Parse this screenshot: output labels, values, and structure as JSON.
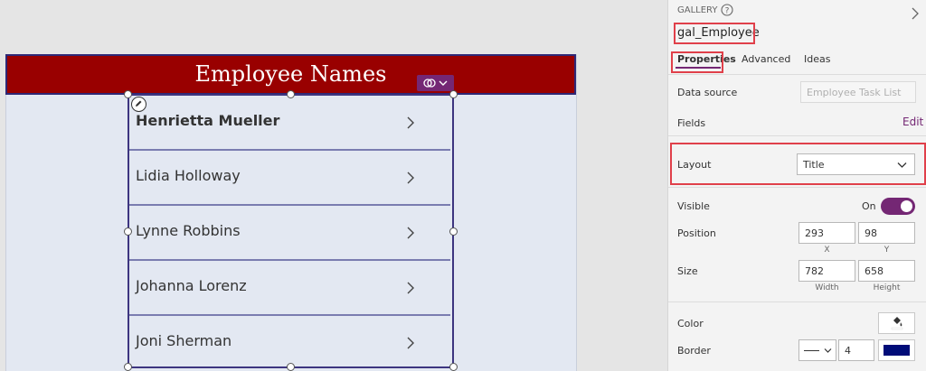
{
  "app_header": {
    "title": "Employee Names"
  },
  "gallery": {
    "items": [
      {
        "name": "Henrietta Mueller"
      },
      {
        "name": "Lidia Holloway"
      },
      {
        "name": "Lynne Robbins"
      },
      {
        "name": "Johanna Lorenz"
      },
      {
        "name": "Joni Sherman"
      }
    ]
  },
  "panel": {
    "section_label": "GALLERY",
    "control_name": "gal_Employee",
    "tabs": [
      {
        "label": "Properties",
        "active": true
      },
      {
        "label": "Advanced",
        "active": false
      },
      {
        "label": "Ideas",
        "active": false
      }
    ],
    "data_source": {
      "label": "Data source",
      "value": "Employee Task List"
    },
    "fields": {
      "label": "Fields",
      "action": "Edit"
    },
    "layout": {
      "label": "Layout",
      "value": "Title"
    },
    "visible": {
      "label": "Visible",
      "state": "On"
    },
    "position": {
      "label": "Position",
      "x": "293",
      "y": "98",
      "x_label": "X",
      "y_label": "Y"
    },
    "size": {
      "label": "Size",
      "width": "782",
      "height": "658",
      "width_label": "Width",
      "height_label": "Height"
    },
    "color": {
      "label": "Color"
    },
    "border": {
      "label": "Border",
      "thickness": "4",
      "color": "#000c78"
    }
  },
  "colors": {
    "header": "#990000",
    "accent": "#742774",
    "highlight": "#e0404a"
  }
}
